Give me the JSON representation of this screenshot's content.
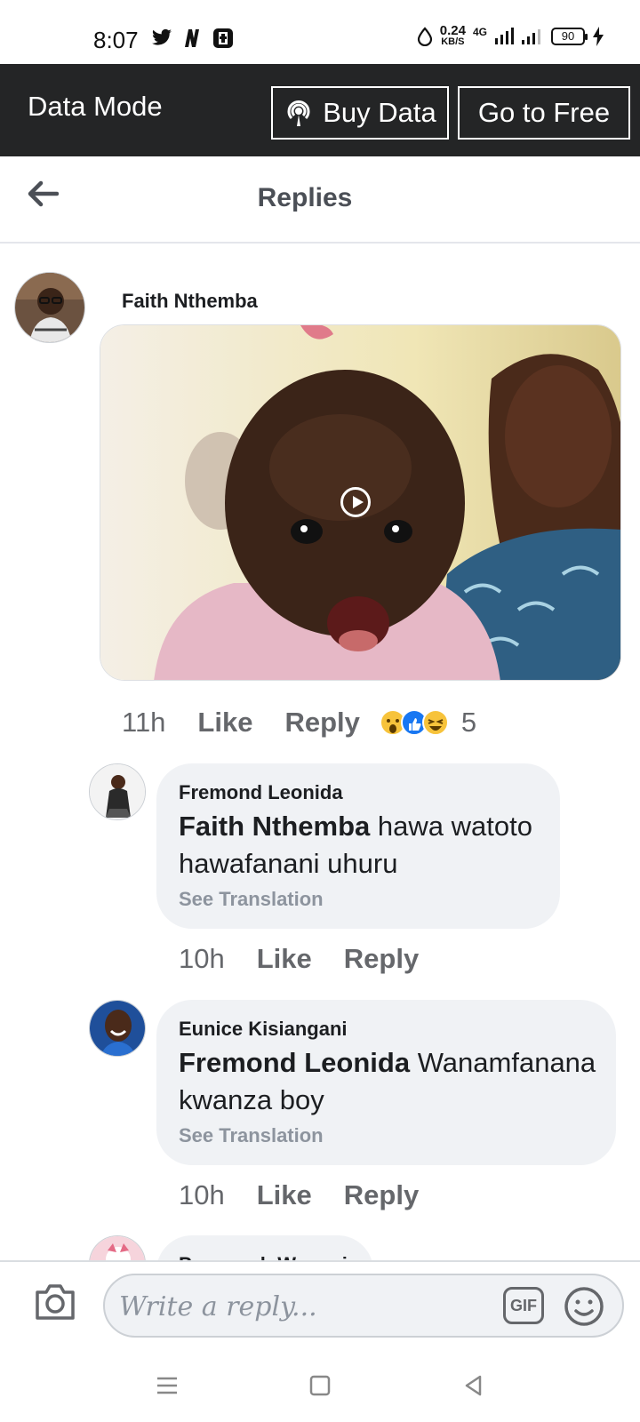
{
  "status": {
    "time": "8:07",
    "net_speed_value": "0.24",
    "net_speed_unit": "KB/S",
    "network": "4G",
    "battery": "90"
  },
  "data_mode": {
    "title": "Data Mode",
    "buy_data": "Buy Data",
    "go_free": "Go to Free"
  },
  "header": {
    "title": "Replies"
  },
  "post": {
    "author": "Faith Nthemba",
    "time": "11h",
    "like": "Like",
    "reply": "Reply",
    "reaction_count": "5"
  },
  "replies": [
    {
      "author": "Fremond Leonida",
      "mention": "Faith Nthemba",
      "text_line1": " hawa watoto",
      "text_line2": "hawafanani uhuru",
      "see_translation": "See Translation",
      "time": "10h",
      "like": "Like",
      "reply": "Reply"
    },
    {
      "author": "Eunice Kisiangani",
      "mention": "Fremond Leonida",
      "text_line1": " Wanamfanana",
      "text_line2": "kwanza boy",
      "see_translation": "See Translation",
      "time": "10h",
      "like": "Like",
      "reply": "Reply"
    },
    {
      "author": "Pennynah Wangui"
    }
  ],
  "composer": {
    "placeholder": "Write a reply...",
    "gif_label": "GIF"
  },
  "colors": {
    "data_bar": "#242526",
    "bubble": "#f0f2f5",
    "secondary_text": "#65676b"
  }
}
